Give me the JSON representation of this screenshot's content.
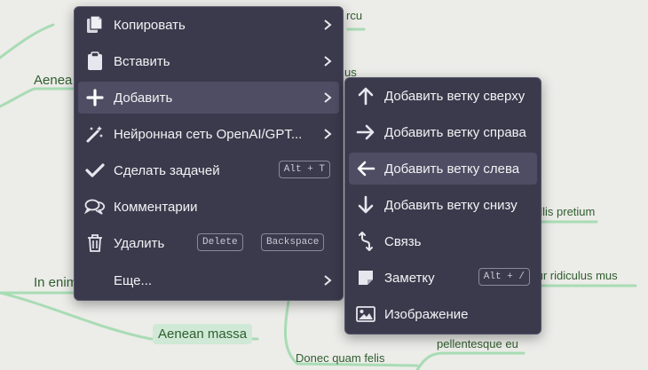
{
  "mindmap": {
    "nodes": {
      "top_fragment": "rcu",
      "aenea": "Aenea",
      "us_fragment": "us",
      "in_enim": "In enim",
      "mollis": "ollis pretium",
      "tur": "tur ridiculus mus",
      "aenean_massa": "Aenean massa",
      "pellentesque": "pellentesque eu",
      "donec": "Donec quam felis"
    },
    "colors": {
      "branch": "#a8dcb4",
      "text": "#2f5e2e",
      "selected_bg": "#cfe9d6"
    }
  },
  "context_menu": {
    "items": [
      {
        "label": "Копировать",
        "icon": "copy-icon",
        "submenu": true
      },
      {
        "label": "Вставить",
        "icon": "paste-icon",
        "submenu": true
      },
      {
        "label": "Добавить",
        "icon": "plus-icon",
        "submenu": true,
        "active": true
      },
      {
        "label": "Нейронная сеть OpenAI/GPT...",
        "icon": "magic-wand-icon",
        "submenu": true
      },
      {
        "label": "Сделать задачей",
        "icon": "check-icon",
        "shortcut": "Alt + T"
      },
      {
        "label": "Комментарии",
        "icon": "comments-icon"
      },
      {
        "label": "Удалить",
        "icon": "trash-icon",
        "shortcuts": [
          "Delete",
          "Backspace"
        ]
      },
      {
        "label": "Еще...",
        "icon": "",
        "submenu": true
      }
    ]
  },
  "submenu": {
    "items": [
      {
        "label": "Добавить ветку сверху",
        "icon": "arrow-up-icon"
      },
      {
        "label": "Добавить ветку справа",
        "icon": "arrow-right-icon"
      },
      {
        "label": "Добавить ветку слева",
        "icon": "arrow-left-icon",
        "active": true
      },
      {
        "label": "Добавить ветку снизу",
        "icon": "arrow-down-icon"
      },
      {
        "label": "Связь",
        "icon": "link-arrows-icon"
      },
      {
        "label": "Заметку",
        "icon": "note-icon",
        "shortcut": "Alt + /"
      },
      {
        "label": "Изображение",
        "icon": "image-icon"
      }
    ]
  }
}
